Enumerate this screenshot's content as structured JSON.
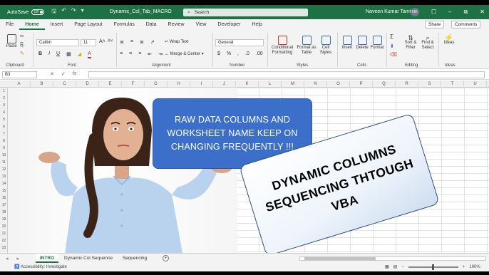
{
  "titlebar": {
    "autosave_label": "AutoSave",
    "autosave_state": "Off",
    "doc_title": "Dynamic_Col_Tab_MACRO",
    "search_placeholder": "Search",
    "user_name": "Naveen Kumar Tamta",
    "user_initials": "NK",
    "accent": "#1e7145"
  },
  "menu": {
    "items": [
      "File",
      "Home",
      "Insert",
      "Page Layout",
      "Formulas",
      "Data",
      "Review",
      "View",
      "Developer",
      "Help"
    ],
    "active": "Home",
    "share_label": "Share",
    "comments_label": "Comments"
  },
  "ribbon": {
    "paste_label": "Paste",
    "font_name": "Calibri",
    "font_size": "11",
    "wrap_text": "Wrap Text",
    "merge_center": "Merge & Center",
    "number_format": "General",
    "conditional_formatting": "Conditional Formatting",
    "format_as_table": "Format as Table",
    "cell_styles": "Cell Styles",
    "insert": "Insert",
    "delete": "Delete",
    "format": "Format",
    "sort_filter": "Sort & Filter",
    "find_select": "Find & Select",
    "ideas": "Ideas",
    "groups": [
      "Clipboard",
      "Font",
      "Alignment",
      "Number",
      "Styles",
      "Cells",
      "Editing",
      "Ideas"
    ]
  },
  "formula_bar": {
    "name_box": "B3",
    "fx_label": "fx",
    "formula": ""
  },
  "grid": {
    "columns": [
      "A",
      "B",
      "C",
      "D",
      "E",
      "F",
      "G",
      "H",
      "I",
      "J",
      "K",
      "L",
      "M",
      "N",
      "O",
      "P",
      "Q",
      "R",
      "S",
      "T",
      "U"
    ],
    "rows": [
      "1",
      "2",
      "3",
      "4",
      "5",
      "6",
      "7",
      "8",
      "9",
      "10",
      "11",
      "12",
      "13",
      "14",
      "15",
      "16",
      "17",
      "18",
      "19",
      "20",
      "21",
      "22",
      "23"
    ]
  },
  "callouts": {
    "blue_text": "RAW DATA COLUMNS AND WORKSHEET NAME KEEP ON CHANGING FREQUENTLY !!!",
    "white_text": "DYNAMIC COLUMNS SEQUENCING THTOUGH VBA"
  },
  "sheet_tabs": {
    "tabs": [
      "INTRO",
      "Dynamic Col Sequence",
      "Sequencing"
    ],
    "active": "INTRO"
  },
  "status": {
    "accessibility": "Accessibility: Investigate",
    "zoom": "100%"
  }
}
